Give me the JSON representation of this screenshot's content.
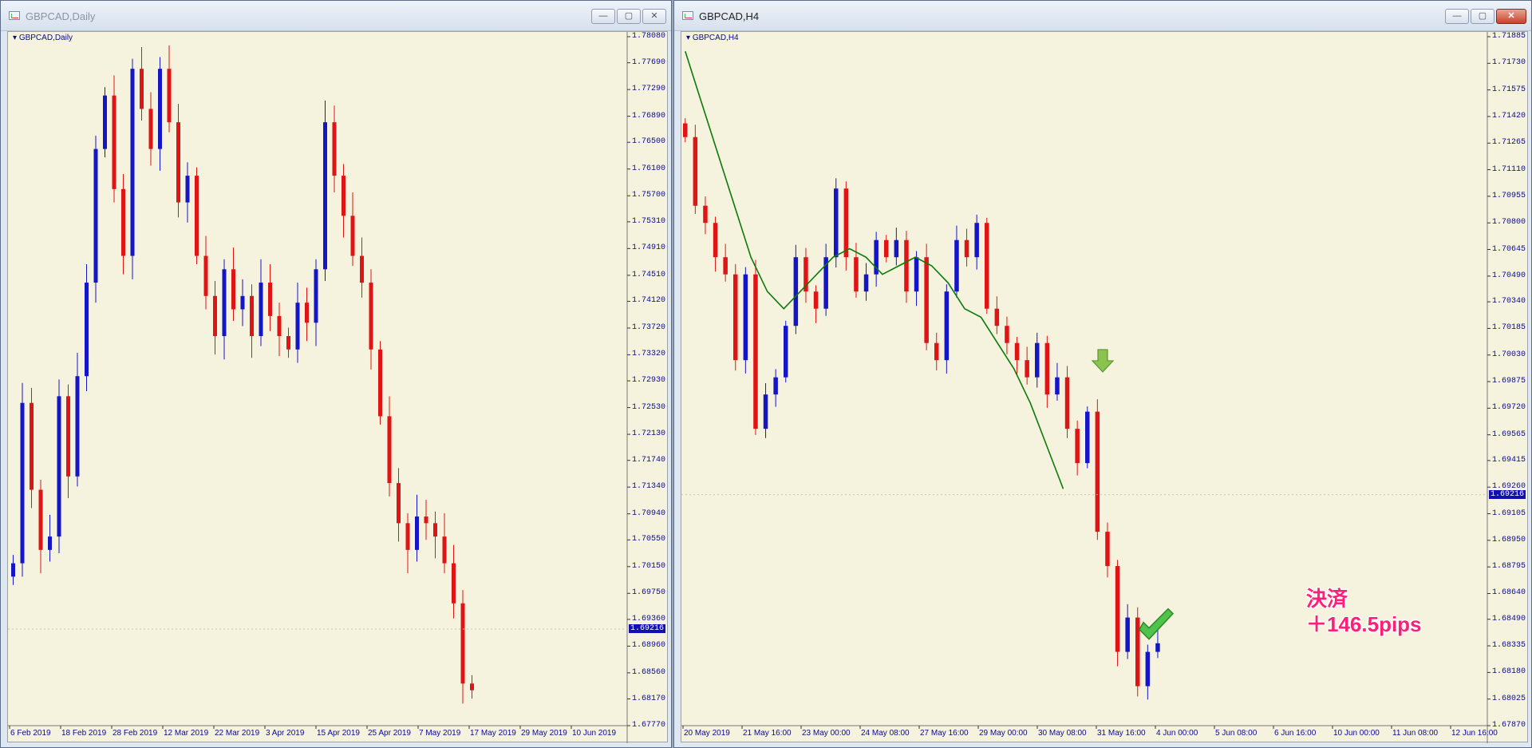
{
  "left_window": {
    "title": "GBPCAD,Daily",
    "symbol_label": "GBPCAD,Daily",
    "current_price": "1.69216",
    "chart_data": {
      "type": "candlestick",
      "title": "GBPCAD,Daily",
      "ylim": [
        1.6777,
        1.7808
      ],
      "y_ticks": [
        "1.78080",
        "1.77690",
        "1.77290",
        "1.76890",
        "1.76500",
        "1.76100",
        "1.75700",
        "1.75310",
        "1.74910",
        "1.74510",
        "1.74120",
        "1.73720",
        "1.73320",
        "1.72930",
        "1.72530",
        "1.72130",
        "1.71740",
        "1.71340",
        "1.70940",
        "1.70550",
        "1.70150",
        "1.69750",
        "1.69360",
        "1.68960",
        "1.68560",
        "1.68170",
        "1.67770"
      ],
      "x_ticks": [
        "6 Feb 2019",
        "18 Feb 2019",
        "28 Feb 2019",
        "12 Mar 2019",
        "22 Mar 2019",
        "3 Apr 2019",
        "15 Apr 2019",
        "25 Apr 2019",
        "7 May 2019",
        "17 May 2019",
        "29 May 2019",
        "10 Jun 2019"
      ],
      "close_path": [
        1.702,
        1.726,
        1.713,
        1.704,
        1.706,
        1.727,
        1.715,
        1.73,
        1.744,
        1.764,
        1.772,
        1.758,
        1.748,
        1.776,
        1.77,
        1.764,
        1.776,
        1.768,
        1.756,
        1.76,
        1.748,
        1.742,
        1.736,
        1.746,
        1.74,
        1.742,
        1.736,
        1.744,
        1.739,
        1.736,
        1.734,
        1.741,
        1.738,
        1.746,
        1.768,
        1.76,
        1.754,
        1.748,
        1.744,
        1.734,
        1.724,
        1.714,
        1.708,
        1.704,
        1.709,
        1.708,
        1.706,
        1.702,
        1.696,
        1.684,
        1.683
      ],
      "current": 1.69216
    }
  },
  "right_window": {
    "title": "GBPCAD,H4",
    "symbol_label": "GBPCAD,H4",
    "current_price": "1.69216",
    "chart_data": {
      "type": "candlestick",
      "title": "GBPCAD,H4",
      "ylim": [
        1.6787,
        1.71885
      ],
      "y_ticks": [
        "1.71885",
        "1.71730",
        "1.71575",
        "1.71420",
        "1.71265",
        "1.71110",
        "1.70955",
        "1.70800",
        "1.70645",
        "1.70490",
        "1.70340",
        "1.70185",
        "1.70030",
        "1.69875",
        "1.69720",
        "1.69565",
        "1.69415",
        "1.69260",
        "1.69105",
        "1.68950",
        "1.68795",
        "1.68640",
        "1.68490",
        "1.68335",
        "1.68180",
        "1.68025",
        "1.67870"
      ],
      "x_ticks": [
        "20 May 2019",
        "21 May 16:00",
        "23 May 00:00",
        "24 May 08:00",
        "27 May 16:00",
        "29 May 00:00",
        "30 May 08:00",
        "31 May 16:00",
        "4 Jun 00:00",
        "5 Jun 08:00",
        "6 Jun 16:00",
        "10 Jun 00:00",
        "11 Jun 08:00",
        "12 Jun 16:00"
      ],
      "close_path": [
        1.713,
        1.709,
        1.708,
        1.706,
        1.705,
        1.7,
        1.705,
        1.696,
        1.698,
        1.699,
        1.702,
        1.706,
        1.704,
        1.703,
        1.706,
        1.71,
        1.706,
        1.704,
        1.705,
        1.707,
        1.706,
        1.707,
        1.704,
        1.706,
        1.701,
        1.7,
        1.704,
        1.707,
        1.706,
        1.708,
        1.703,
        1.702,
        1.701,
        1.7,
        1.699,
        1.701,
        1.698,
        1.699,
        1.696,
        1.694,
        1.697,
        1.69,
        1.688,
        1.683,
        1.685,
        1.681,
        1.683,
        1.6835
      ],
      "moving_average": [
        1.718,
        1.715,
        1.712,
        1.709,
        1.706,
        1.704,
        1.703,
        1.704,
        1.705,
        1.706,
        1.7065,
        1.706,
        1.705,
        1.7055,
        1.706,
        1.7055,
        1.7045,
        1.703,
        1.7025,
        1.701,
        1.6995,
        1.6975,
        1.695,
        1.6925
      ],
      "current": 1.69216,
      "annotation": [
        "決済",
        "＋146.5pips"
      ]
    }
  }
}
